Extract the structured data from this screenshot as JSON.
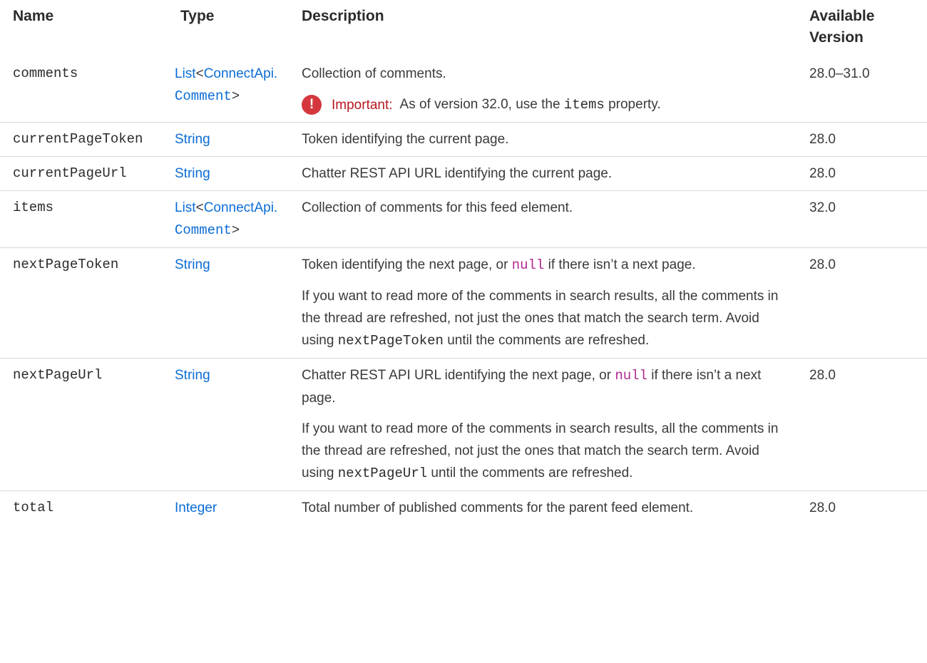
{
  "headers": {
    "name": "Name",
    "type": "Type",
    "description": "Description",
    "version_line1": "Available",
    "version_line2": "Version"
  },
  "rows": {
    "comments": {
      "name": "comments",
      "type_list": "List",
      "type_class": "ConnectApi.",
      "type_comment": "Comment",
      "type_close": ">",
      "desc": "Collection of comments.",
      "important_label": "Important:",
      "important_text_1": "As of version 32.0, use the",
      "important_code": "items",
      "important_text_2": "property.",
      "version": "28.0–31.0"
    },
    "currentPageToken": {
      "name": "currentPageToken",
      "type": "String",
      "desc": "Token identifying the current page.",
      "version": "28.0"
    },
    "currentPageUrl": {
      "name": "currentPageUrl",
      "type": "String",
      "desc": "Chatter REST API URL identifying the current page.",
      "version": "28.0"
    },
    "items": {
      "name": "items",
      "type_list": "List",
      "type_class": "ConnectApi.",
      "type_comment": "Comment",
      "type_close": ">",
      "desc": "Collection of comments for this feed element.",
      "version": "32.0"
    },
    "nextPageToken": {
      "name": "nextPageToken",
      "type": "String",
      "desc1_a": "Token identifying the next page, or",
      "desc1_null": "null",
      "desc1_b": "if there isn’t a next page.",
      "desc2_a": "If you want to read more of the comments in search results, all the comments in the thread are refreshed, not just the ones that match the search term. Avoid using",
      "desc2_code": "nextPageToken",
      "desc2_b": "until the comments are refreshed.",
      "version": "28.0"
    },
    "nextPageUrl": {
      "name": "nextPageUrl",
      "type": "String",
      "desc1_a": "Chatter REST API URL identifying the next page, or",
      "desc1_null": "null",
      "desc1_b": "if there isn’t a next page.",
      "desc2_a": "If you want to read more of the comments in search results, all the comments in the thread are refreshed, not just the ones that match the search term. Avoid using",
      "desc2_code": "nextPageUrl",
      "desc2_b": "until the comments are refreshed.",
      "version": "28.0"
    },
    "total": {
      "name": "total",
      "type": "Integer",
      "desc": "Total number of published comments for the parent feed element.",
      "version": "28.0"
    }
  },
  "icons": {
    "important": "exclamation-circle-icon",
    "important_glyph": "!"
  },
  "colors": {
    "link": "#0b6cd6",
    "null_keyword": "#b3278e",
    "important": "#d4383e"
  }
}
